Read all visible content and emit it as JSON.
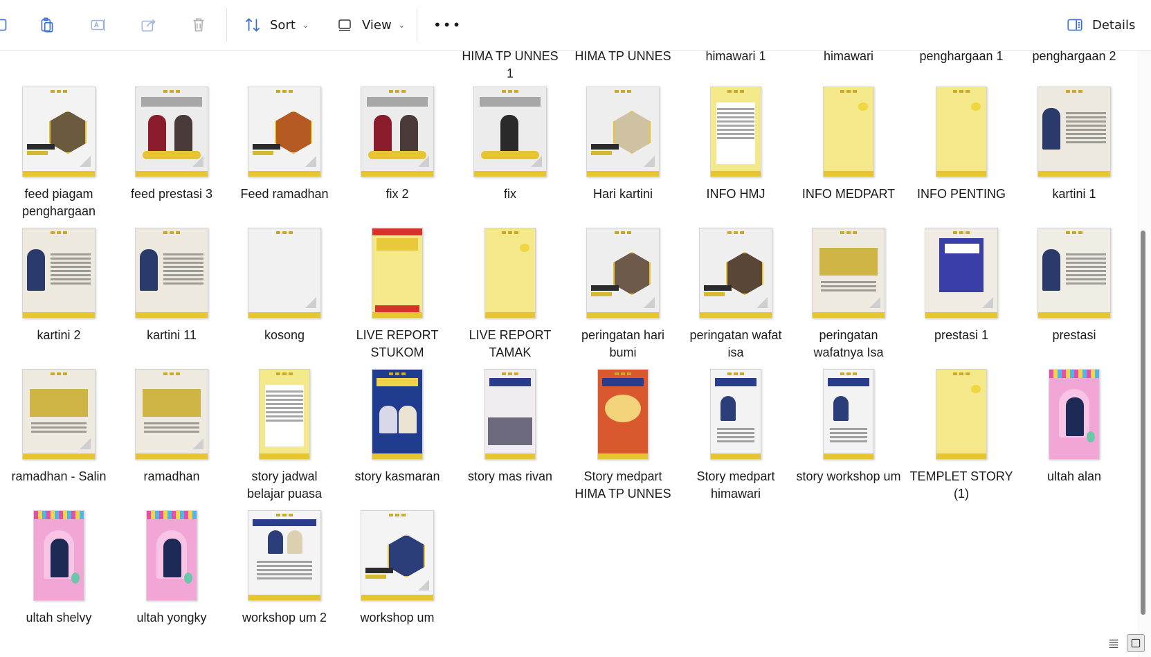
{
  "toolbar": {
    "sort_label": "Sort",
    "view_label": "View",
    "more_label": "•••",
    "details_label": "Details",
    "icons": [
      "copy-icon",
      "paste-icon",
      "rename-icon",
      "share-icon",
      "delete-icon",
      "sort-icon",
      "view-icon",
      "more-icon",
      "details-pane-icon"
    ]
  },
  "top_row_labels": [
    "HIMA TP UNNES 1",
    "HIMA TP UNNES",
    "himawari 1",
    "himawari",
    "penghargaan 1",
    "penghargaan 2"
  ],
  "files": [
    {
      "name": "feed piagam penghargaan",
      "kind": "feed",
      "theme": "piagam"
    },
    {
      "name": "feed prestasi 3",
      "kind": "feed",
      "theme": "prestasi2"
    },
    {
      "name": "Feed ramadhan",
      "kind": "feed",
      "theme": "ramadhan"
    },
    {
      "name": "fix 2",
      "kind": "feed",
      "theme": "prestasi2"
    },
    {
      "name": "fix",
      "kind": "feed",
      "theme": "prestasi1"
    },
    {
      "name": "Hari kartini",
      "kind": "feed",
      "theme": "kartini-hex"
    },
    {
      "name": "INFO HMJ",
      "kind": "story",
      "theme": "info-doc"
    },
    {
      "name": "INFO MEDPART",
      "kind": "story",
      "theme": "yellow-blank"
    },
    {
      "name": "INFO PENTING",
      "kind": "story",
      "theme": "yellow-blank"
    },
    {
      "name": "kartini 1",
      "kind": "feed",
      "theme": "kartini-text"
    },
    {
      "name": "kartini 2",
      "kind": "feed",
      "theme": "kartini-text"
    },
    {
      "name": "kartini 11",
      "kind": "feed",
      "theme": "kartini-text"
    },
    {
      "name": "kosong",
      "kind": "feed",
      "theme": "blank"
    },
    {
      "name": "LIVE REPORT STUKOM",
      "kind": "story",
      "theme": "live"
    },
    {
      "name": "LIVE REPORT TAMAK",
      "kind": "story",
      "theme": "yellow-blank"
    },
    {
      "name": "peringatan hari bumi",
      "kind": "feed",
      "theme": "bumi-hex"
    },
    {
      "name": "peringatan wafat isa",
      "kind": "feed",
      "theme": "isa-hex"
    },
    {
      "name": "peringatan wafatnya Isa",
      "kind": "feed",
      "theme": "yellow-text"
    },
    {
      "name": "prestasi 1",
      "kind": "feed",
      "theme": "kartini-poster"
    },
    {
      "name": "prestasi",
      "kind": "feed",
      "theme": "prestasi-person"
    },
    {
      "name": "ramadhan - Salin",
      "kind": "feed",
      "theme": "yellow-text"
    },
    {
      "name": "ramadhan",
      "kind": "feed",
      "theme": "yellow-text"
    },
    {
      "name": "story jadwal belajar puasa",
      "kind": "story",
      "theme": "info-doc"
    },
    {
      "name": "story kasmaran",
      "kind": "story",
      "theme": "blue-poster"
    },
    {
      "name": "story mas rivan",
      "kind": "story",
      "theme": "crowd-poster"
    },
    {
      "name": "Story medpart HIMA TP UNNES",
      "kind": "story",
      "theme": "red-poster"
    },
    {
      "name": "Story medpart himawari",
      "kind": "story",
      "theme": "white-poster"
    },
    {
      "name": "story workshop um",
      "kind": "story",
      "theme": "white-poster"
    },
    {
      "name": "TEMPLET STORY (1)",
      "kind": "story",
      "theme": "yellow-blank"
    },
    {
      "name": "ultah alan",
      "kind": "story",
      "theme": "pink"
    },
    {
      "name": "ultah shelvy",
      "kind": "story",
      "theme": "pink"
    },
    {
      "name": "ultah yongky",
      "kind": "story",
      "theme": "pink"
    },
    {
      "name": "workshop um 2",
      "kind": "feed",
      "theme": "workshop"
    },
    {
      "name": "workshop um",
      "kind": "feed",
      "theme": "workshop-hex"
    }
  ],
  "colors": {
    "accent_yellow": "#e6c530",
    "kartini_bg": "#eee9df",
    "pink": "#f2a6d6",
    "selected_border": "#9a9a9a"
  },
  "status_bar": {
    "icons": [
      "details-view-icon",
      "large-icons-view-icon"
    ]
  }
}
